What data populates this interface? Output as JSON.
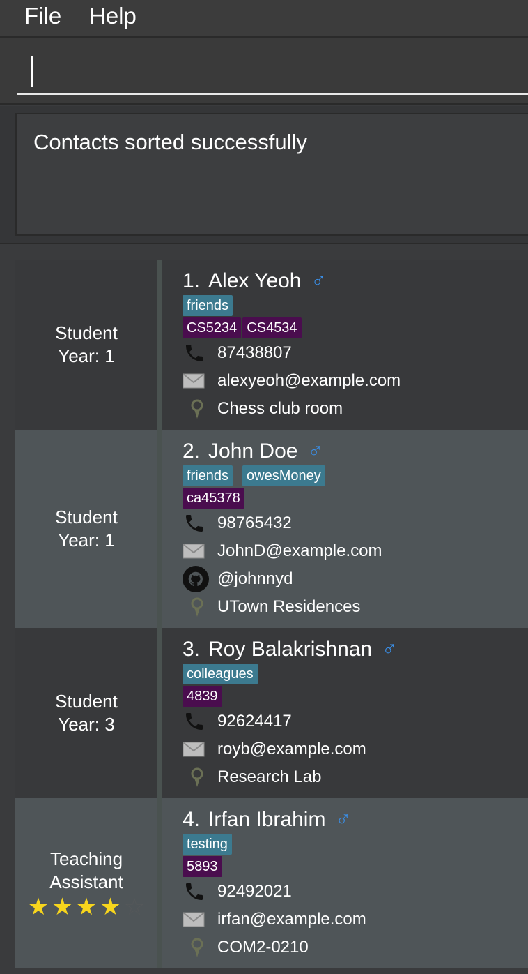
{
  "menu": {
    "file": "File",
    "help": "Help"
  },
  "command": {
    "value": ""
  },
  "result": {
    "message": "Contacts sorted successfully"
  },
  "persons": [
    {
      "index": "1.",
      "name": "Alex Yeoh",
      "gender_icon": "male-icon",
      "role_line1": "Student",
      "role_line2": "Year: 1",
      "tags": [
        "friends"
      ],
      "modules": [
        "CS5234",
        "CS4534"
      ],
      "phone": "87438807",
      "email": "alexyeoh@example.com",
      "location": "Chess club room"
    },
    {
      "index": "2.",
      "name": "John Doe",
      "gender_icon": "male-icon",
      "role_line1": "Student",
      "role_line2": "Year: 1",
      "tags": [
        "friends",
        "owesMoney"
      ],
      "modules": [
        "ca45378"
      ],
      "phone": "98765432",
      "email": "JohnD@example.com",
      "github": "@johnnyd",
      "location": "UTown Residences"
    },
    {
      "index": "3.",
      "name": "Roy Balakrishnan",
      "gender_icon": "male-icon",
      "role_line1": "Student",
      "role_line2": "Year: 3",
      "tags": [
        "colleagues"
      ],
      "modules": [
        "4839"
      ],
      "phone": "92624417",
      "email": "royb@example.com",
      "location": "Research Lab"
    },
    {
      "index": "4.",
      "name": "Irfan Ibrahim",
      "gender_icon": "male-icon",
      "role_line1": "Teaching",
      "role_line2": "Assistant",
      "rating": 4,
      "rating_max": 5,
      "tags": [
        "testing"
      ],
      "modules": [
        "5893"
      ],
      "phone": "92492021",
      "email": "irfan@example.com",
      "location": "COM2-0210"
    }
  ],
  "colors": {
    "tag": "#3c7a8f",
    "module": "#4a0d4e",
    "gender": "#3a8ee6",
    "row_dark": "#38393b",
    "row_light": "#4f5558",
    "star_on": "#f7d51d"
  }
}
